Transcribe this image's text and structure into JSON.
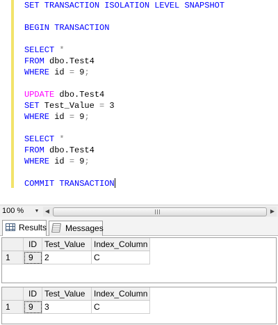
{
  "editor": {
    "lines": [
      [
        {
          "t": "SET TRANSACTION ISOLATION LEVEL SNAPSHOT",
          "c": "kw"
        }
      ],
      [],
      [
        {
          "t": "BEGIN TRANSACTION",
          "c": "kw"
        }
      ],
      [],
      [
        {
          "t": "SELECT",
          "c": "kw"
        },
        {
          "t": " ",
          "c": "id"
        },
        {
          "t": "*",
          "c": "kw-gray"
        }
      ],
      [
        {
          "t": "FROM",
          "c": "kw"
        },
        {
          "t": " dbo.Test4",
          "c": "id"
        }
      ],
      [
        {
          "t": "WHERE",
          "c": "kw"
        },
        {
          "t": " id ",
          "c": "id"
        },
        {
          "t": "=",
          "c": "kw-gray"
        },
        {
          "t": " 9",
          "c": "num"
        },
        {
          "t": ";",
          "c": "kw-gray"
        }
      ],
      [],
      [
        {
          "t": "UPDATE",
          "c": "kw-pink"
        },
        {
          "t": " dbo.Test4",
          "c": "id"
        }
      ],
      [
        {
          "t": "SET",
          "c": "kw"
        },
        {
          "t": " Test_Value ",
          "c": "id"
        },
        {
          "t": "=",
          "c": "kw-gray"
        },
        {
          "t": " 3",
          "c": "num"
        }
      ],
      [
        {
          "t": "WHERE",
          "c": "kw"
        },
        {
          "t": " id ",
          "c": "id"
        },
        {
          "t": "=",
          "c": "kw-gray"
        },
        {
          "t": " 9",
          "c": "num"
        },
        {
          "t": ";",
          "c": "kw-gray"
        }
      ],
      [],
      [
        {
          "t": "SELECT",
          "c": "kw"
        },
        {
          "t": " ",
          "c": "id"
        },
        {
          "t": "*",
          "c": "kw-gray"
        }
      ],
      [
        {
          "t": "FROM",
          "c": "kw"
        },
        {
          "t": " dbo.Test4",
          "c": "id"
        }
      ],
      [
        {
          "t": "WHERE",
          "c": "kw"
        },
        {
          "t": " id ",
          "c": "id"
        },
        {
          "t": "=",
          "c": "kw-gray"
        },
        {
          "t": " 9",
          "c": "num"
        },
        {
          "t": ";",
          "c": "kw-gray"
        }
      ],
      [],
      [
        {
          "t": "COMMIT TRANSACTION",
          "c": "kw"
        }
      ]
    ],
    "caret_line": 16
  },
  "statusbar": {
    "zoom": "100 %"
  },
  "tabs": {
    "results_label": "Results",
    "messages_label": "Messages"
  },
  "results": [
    {
      "columns": [
        "ID",
        "Test_Value",
        "Index_Column"
      ],
      "rows": [
        {
          "rownum": "1",
          "cells": [
            "9",
            "2",
            "C"
          ]
        }
      ]
    },
    {
      "columns": [
        "ID",
        "Test_Value",
        "Index_Column"
      ],
      "rows": [
        {
          "rownum": "1",
          "cells": [
            "9",
            "3",
            "C"
          ]
        }
      ]
    }
  ],
  "colors": {
    "keyword": "#0000ff",
    "update_keyword": "#ff00ff",
    "operator": "#808080",
    "change_bar": "#f2e36a"
  }
}
